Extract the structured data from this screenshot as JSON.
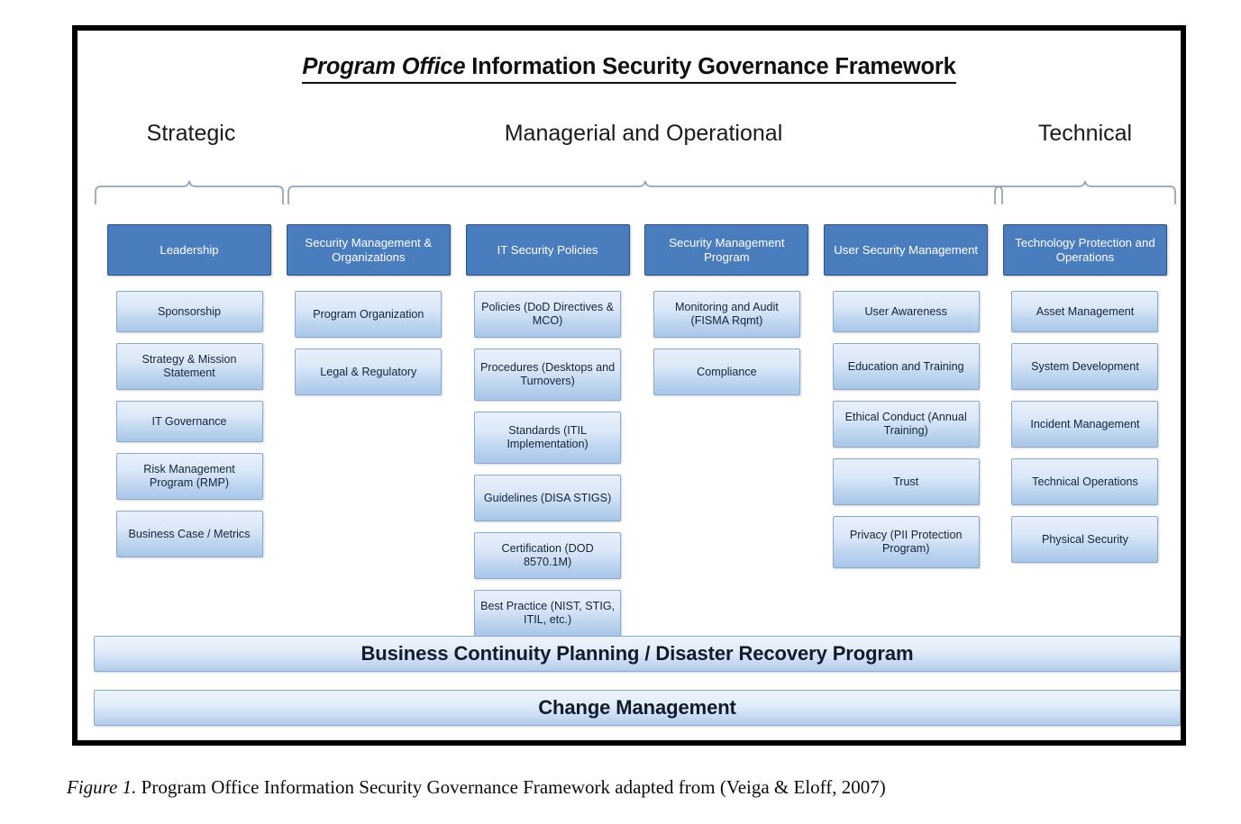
{
  "figure": {
    "title_italic": "Program Office",
    "title_rest": " Information Security Governance Framework",
    "caption_label": "Figure 1.",
    "caption_text": " Program Office Information Security Governance Framework adapted from (Veiga & Eloff, 2007)"
  },
  "colors": {
    "header_box": "#4a7dbd",
    "header_box_border": "#2b5382",
    "sub_box_border": "#8aa9ce",
    "frame": "#000000",
    "brace": "#8fa3b2"
  },
  "groups": [
    {
      "label": "Strategic"
    },
    {
      "label": "Managerial and Operational"
    },
    {
      "label": "Technical"
    }
  ],
  "columns": [
    {
      "header": "Leadership",
      "items": [
        "Sponsorship",
        "Strategy & Mission Statement",
        "IT Governance",
        "Risk Management Program (RMP)",
        "Business Case / Metrics"
      ]
    },
    {
      "header": "Security Management & Organizations",
      "items": [
        "Program Organization",
        "Legal & Regulatory"
      ]
    },
    {
      "header": "IT Security Policies",
      "items": [
        "Policies (DoD Directives & MCO)",
        "Procedures (Desktops and Turnovers)",
        "Standards (ITIL Implementation)",
        "Guidelines (DISA STIGS)",
        "Certification (DOD 8570.1M)",
        "Best Practice (NIST, STIG, ITIL, etc.)"
      ]
    },
    {
      "header": "Security Management Program",
      "items": [
        "Monitoring and Audit (FISMA Rqmt)",
        "Compliance"
      ]
    },
    {
      "header": "User Security Management",
      "items": [
        "User Awareness",
        "Education and Training",
        "Ethical Conduct (Annual Training)",
        "Trust",
        "Privacy (PII Protection Program)"
      ]
    },
    {
      "header": "Technology Protection and Operations",
      "items": [
        "Asset Management",
        "System Development",
        "Incident Management",
        "Technical Operations",
        "Physical Security"
      ]
    }
  ],
  "bottom_bars": [
    "Business Continuity Planning / Disaster Recovery Program",
    "Change Management"
  ]
}
